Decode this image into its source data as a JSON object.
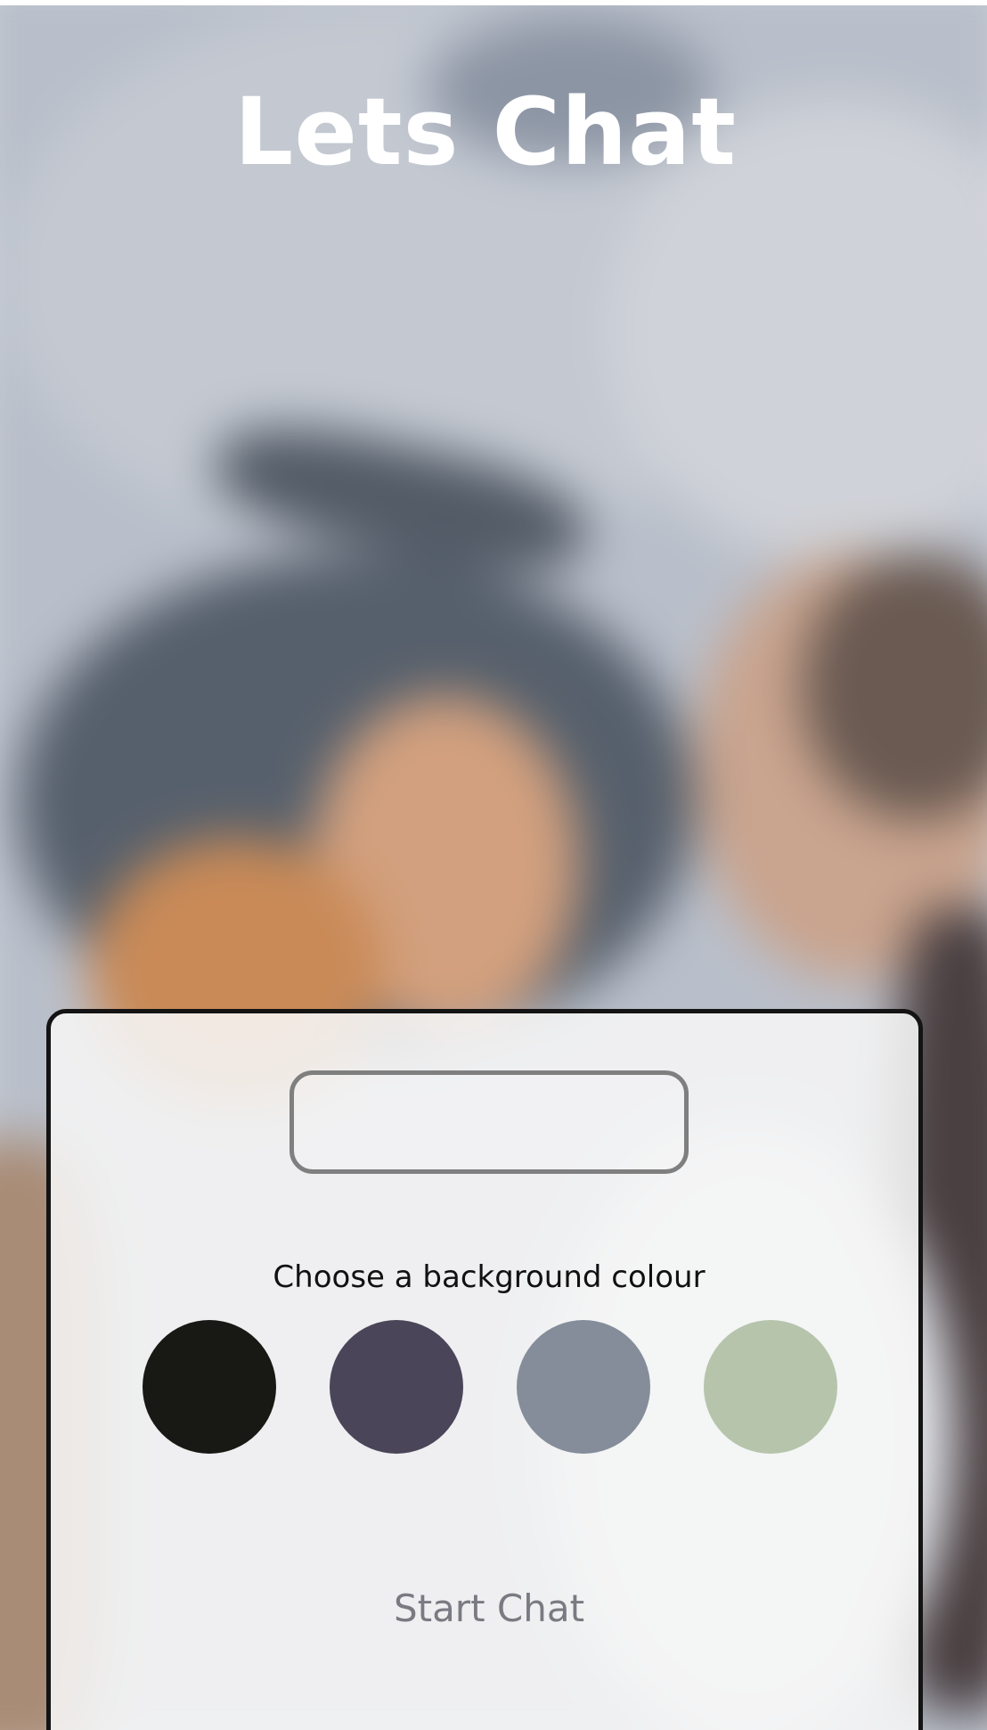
{
  "header": {
    "title": "Lets Chat"
  },
  "form": {
    "name_input_value": "",
    "name_input_placeholder": "",
    "colour_label": "Choose a background colour",
    "colours": [
      {
        "name": "black",
        "hex": "#181814"
      },
      {
        "name": "dark-purple",
        "hex": "#4a4559"
      },
      {
        "name": "slate-grey",
        "hex": "#858d9a"
      },
      {
        "name": "sage-green",
        "hex": "#b6c4ac"
      }
    ],
    "start_label": "Start Chat"
  },
  "icons": {
    "background": "blurred-photo-background"
  }
}
